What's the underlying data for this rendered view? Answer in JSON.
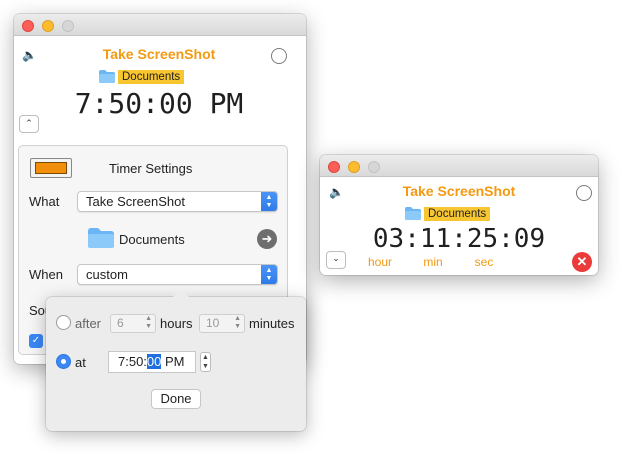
{
  "main_window": {
    "title": "Take ScreenShot",
    "folder": "Documents",
    "time": "7:50:00 PM",
    "collapse_glyph": "⌃",
    "speaker_glyph": "🔈"
  },
  "settings": {
    "heading": "Timer Settings",
    "swatch_color": "#f18e0c",
    "what_label": "What",
    "what_value": "Take ScreenShot",
    "folder": "Documents",
    "when_label": "When",
    "when_value": "custom",
    "sound_label_partial": "Sou"
  },
  "popover": {
    "after_label": "after",
    "hours_value": "6",
    "hours_label": "hours",
    "minutes_value": "10",
    "minutes_label": "minutes",
    "at_label": "at",
    "time_prefix": "7:50:",
    "time_selected": "00",
    "time_suffix": " PM",
    "done_label": "Done",
    "selected_mode": "at"
  },
  "countdown_window": {
    "title": "Take ScreenShot",
    "folder": "Documents",
    "countdown": "03:11:25:09",
    "units": [
      "hour",
      "min",
      "sec"
    ],
    "expand_glyph": "⌄"
  },
  "colors": {
    "accent": "#f39a12",
    "folder_tag": "#f7c631",
    "select_blue": "#3a87f5",
    "cancel_red": "#ea3a3a"
  }
}
